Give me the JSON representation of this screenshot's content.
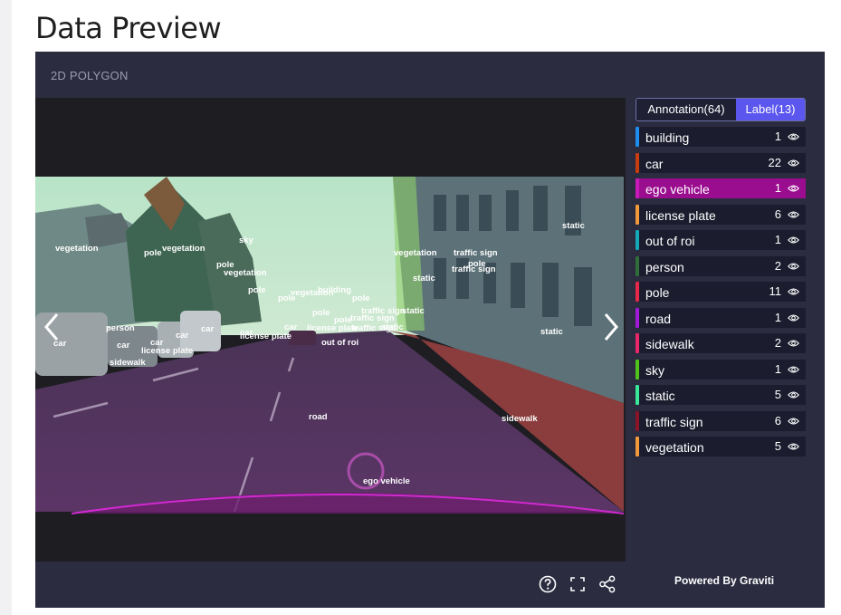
{
  "page": {
    "title": "Data Preview"
  },
  "viewer": {
    "type_label": "2D POLYGON",
    "tabs": {
      "annotation": "Annotation(64)",
      "label": "Label(13)"
    },
    "powered_by": "Powered By Graviti",
    "toolbar_icons": [
      "help-icon",
      "fullscreen-icon",
      "share-icon"
    ],
    "labels": [
      {
        "name": "building",
        "count": "1",
        "color": "#1e8ff0",
        "active": false
      },
      {
        "name": "car",
        "count": "22",
        "color": "#c83d0f",
        "active": false
      },
      {
        "name": "ego vehicle",
        "count": "1",
        "color": "#c81ab8",
        "active": true
      },
      {
        "name": "license plate",
        "count": "6",
        "color": "#f09a3c",
        "active": false
      },
      {
        "name": "out of roi",
        "count": "1",
        "color": "#12a8b8",
        "active": false
      },
      {
        "name": "person",
        "count": "2",
        "color": "#2f6e3a",
        "active": false
      },
      {
        "name": "pole",
        "count": "11",
        "color": "#e8284a",
        "active": false
      },
      {
        "name": "road",
        "count": "1",
        "color": "#a11ad8",
        "active": false
      },
      {
        "name": "sidewalk",
        "count": "2",
        "color": "#e8286a",
        "active": false
      },
      {
        "name": "sky",
        "count": "1",
        "color": "#4ec41a",
        "active": false
      },
      {
        "name": "static",
        "count": "5",
        "color": "#3ae89a",
        "active": false
      },
      {
        "name": "traffic sign",
        "count": "6",
        "color": "#8a1428",
        "active": false
      },
      {
        "name": "vegetation",
        "count": "5",
        "color": "#f09a3c",
        "active": false
      }
    ],
    "image_annotations": [
      "vegetation",
      "pole",
      "vegetation",
      "sky",
      "pole",
      "vegetation",
      "pole",
      "pole",
      "vegetation",
      "building",
      "pole",
      "traffic sign",
      "static",
      "pole",
      "pole",
      "traffic sign",
      "static",
      "vegetation",
      "traffic sign",
      "pole",
      "traffic sign",
      "static",
      "static",
      "person",
      "car",
      "car",
      "car",
      "car",
      "car",
      "license plate",
      "sidewalk",
      "car",
      "car",
      "license plate",
      "license plate",
      "traffic sign",
      "out of roi",
      "static",
      "road",
      "sidewalk",
      "ego vehicle"
    ]
  }
}
